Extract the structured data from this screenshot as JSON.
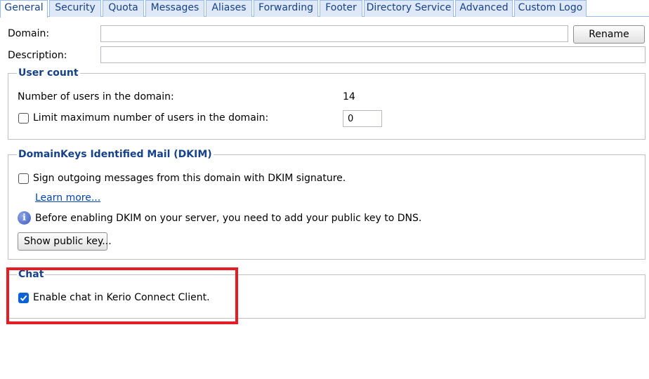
{
  "tabs": [
    {
      "label": "General",
      "active": true
    },
    {
      "label": "Security"
    },
    {
      "label": "Quota"
    },
    {
      "label": "Messages"
    },
    {
      "label": "Aliases"
    },
    {
      "label": "Forwarding"
    },
    {
      "label": "Footer"
    },
    {
      "label": "Directory Service"
    },
    {
      "label": "Advanced"
    },
    {
      "label": "Custom Logo"
    }
  ],
  "form": {
    "domain_label": "Domain:",
    "domain_value": "",
    "rename_button": "Rename",
    "description_label": "Description:",
    "description_value": ""
  },
  "user_count": {
    "legend": "User count",
    "users_label": "Number of users in the domain:",
    "users_value": "14",
    "limit_label": "Limit maximum number of users in the domain:",
    "limit_checked": false,
    "limit_value": "0"
  },
  "dkim": {
    "legend": "DomainKeys Identified Mail (DKIM)",
    "sign_label": "Sign outgoing messages from this domain with DKIM signature.",
    "sign_checked": false,
    "learn_more": "Learn more...",
    "info_text": "Before enabling DKIM on your server, you need to add your public key to DNS.",
    "show_key_button": "Show public key..."
  },
  "chat": {
    "legend": "Chat",
    "enable_label": "Enable chat in Kerio Connect Client.",
    "enable_checked": true
  },
  "colors": {
    "tab_background": "#dee8f6",
    "tab_border": "#99bbe8",
    "legend_text": "#15428b",
    "checkbox_checked": "#0a63d6",
    "highlight_border": "#e51c23"
  },
  "icons": {
    "info": "info-icon",
    "checkmark": "checkmark-icon"
  }
}
